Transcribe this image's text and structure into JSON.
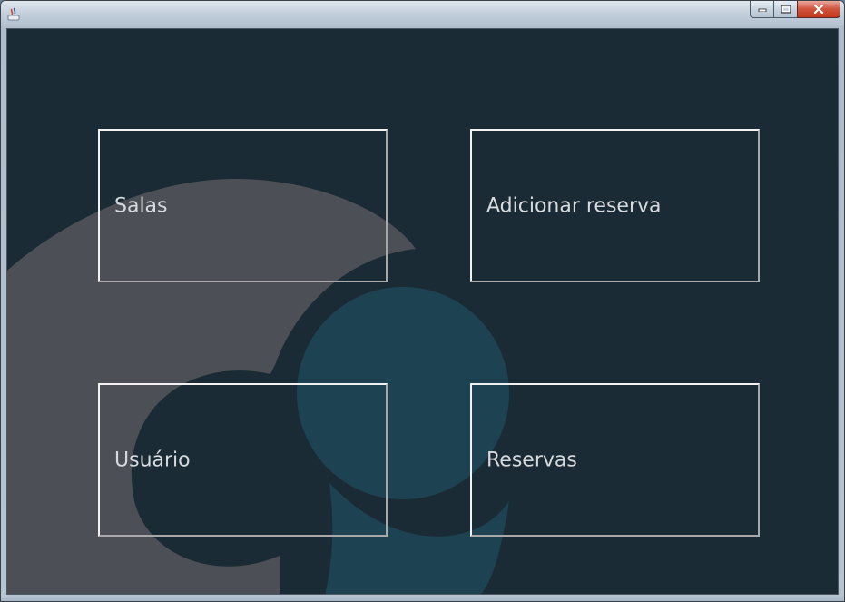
{
  "window": {
    "title": "",
    "controls": {
      "minimize_icon": "minimize-icon",
      "maximize_icon": "maximize-icon",
      "close_icon": "close-icon"
    }
  },
  "menu": {
    "items": [
      {
        "id": "salas",
        "label": "Salas"
      },
      {
        "id": "adicionar-reserva",
        "label": "Adicionar reserva"
      },
      {
        "id": "usuario",
        "label": "Usuário"
      },
      {
        "id": "reservas",
        "label": "Reservas"
      }
    ]
  },
  "colors": {
    "background": "#1b2b36",
    "art_gray": "#4c4f56",
    "art_teal": "#1d4353",
    "label": "#d6dadd",
    "tile_border_light": "#f2f2f2",
    "tile_border_dark": "#a8a8a8"
  }
}
